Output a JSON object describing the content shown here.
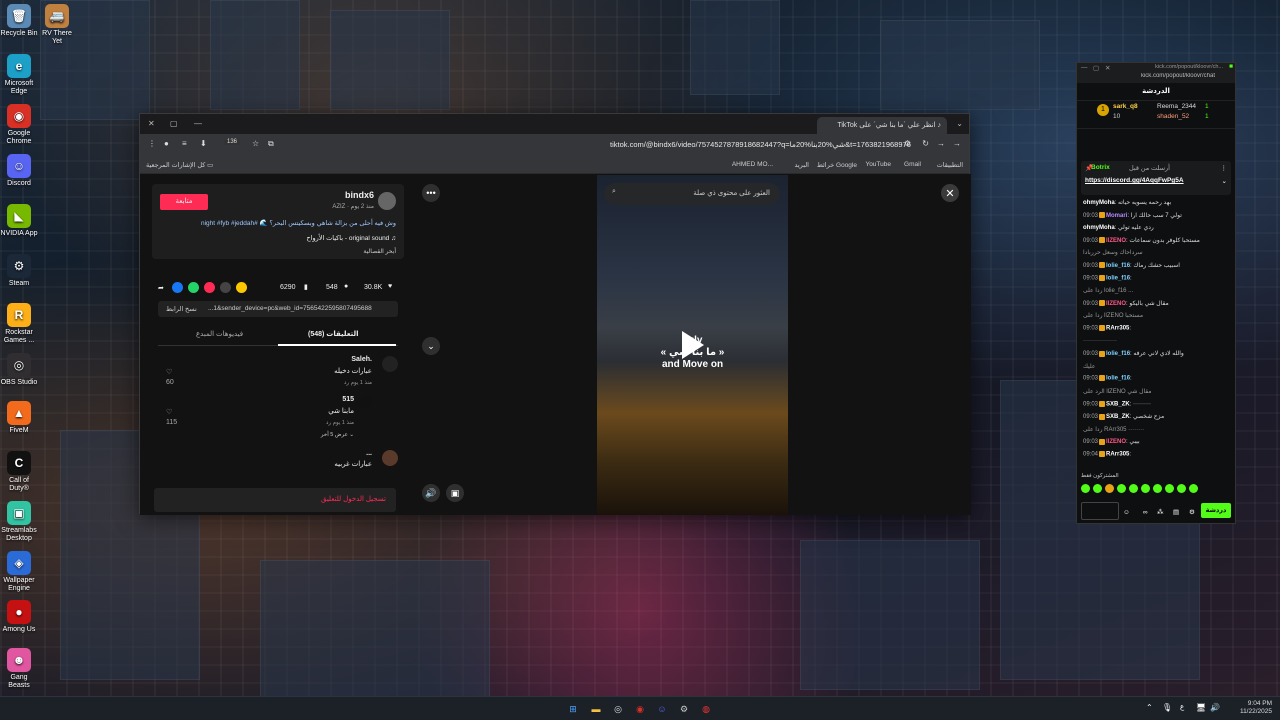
{
  "desktop": {
    "icons": [
      {
        "label": "Recycle Bin",
        "icon": "recycle-bin-icon",
        "color": "#5b8bb5",
        "glyph": "🗑"
      },
      {
        "label": "Microsoft Edge",
        "icon": "edge-icon",
        "color": "#1da0c8",
        "glyph": "e"
      },
      {
        "label": "Google Chrome",
        "icon": "chrome-icon",
        "color": "#d93025",
        "glyph": "◉"
      },
      {
        "label": "Discord",
        "icon": "discord-icon",
        "color": "#5865f2",
        "glyph": "☺"
      },
      {
        "label": "NVIDIA App",
        "icon": "nvidia-icon",
        "color": "#76b900",
        "glyph": "◣"
      },
      {
        "label": "Steam",
        "icon": "steam-icon",
        "color": "#1b2838",
        "glyph": "⚙"
      },
      {
        "label": "Rockstar Games ...",
        "icon": "rockstar-icon",
        "color": "#fcaf17",
        "glyph": "R"
      },
      {
        "label": "OBS Studio",
        "icon": "obs-icon",
        "color": "#302e31",
        "glyph": "◎"
      },
      {
        "label": "FiveM",
        "icon": "fivem-icon",
        "color": "#f26b1d",
        "glyph": "▲"
      },
      {
        "label": "Call of Duty®",
        "icon": "cod-icon",
        "color": "#111111",
        "glyph": "C"
      },
      {
        "label": "Streamlabs Desktop",
        "icon": "streamlabs-icon",
        "color": "#31c3a2",
        "glyph": "▣"
      },
      {
        "label": "Wallpaper Engine",
        "icon": "wallpaper-engine-icon",
        "color": "#2a6bd8",
        "glyph": "◈"
      },
      {
        "label": "Among Us",
        "icon": "among-us-icon",
        "color": "#c51111",
        "glyph": "●"
      },
      {
        "label": "Gang Beasts",
        "icon": "gang-beasts-icon",
        "color": "#e056a0",
        "glyph": "☻"
      }
    ],
    "extra_icon": {
      "label": "RV There Yet",
      "icon": "rv-there-yet-icon",
      "color": "#c08040"
    }
  },
  "browser": {
    "tab_title": "انظر علي ´ما بنا شي´ على TikTok",
    "url": "tiktok.com/@bindx6/video/7574527878918682447?q=شي%20بنا%20ما&t=1763821968976",
    "bookmarks": [
      "التطبيقات",
      "AHMED MO...",
      "البريد",
      "خرائط Google",
      "YouTube",
      "Gmail"
    ],
    "all_bookmarks": "كل الإشارات المرجعية",
    "profile": {
      "username": "bindx6",
      "display": "AZIZ · منذ 2 يوم",
      "follow": "متابعة",
      "caption": "وش فيه أحلى من بزالة شاهي وبسكيتس البحر؟ 🌊 #night #fyb #jeddah",
      "sound": "♫ original sound - باكيات الأرواح",
      "explore": "أبحر القصالية"
    },
    "stats": {
      "likes": "30.8K",
      "comments": "548",
      "saves": "6290"
    },
    "link_label": "نسخ الرابط",
    "link_text": "...1&sender_device=pc&web_id=7565422595807495688",
    "tabs": {
      "comments": "التعليقات (548)",
      "related": "فيديوهات المبدع"
    },
    "comments": [
      {
        "user": "Saleh.",
        "text": "عبارات دخيله",
        "meta": "منذ 1 يوم   رد",
        "likes": "60"
      },
      {
        "user": "515",
        "text": "مابنا شي",
        "meta": "منذ 1 يوم   رد",
        "likes": "115",
        "replies": "عرض 5 آخر ⌄"
      },
      {
        "user": "...",
        "text": "عبارات غربيه",
        "meta": "",
        "likes": ""
      }
    ],
    "login_prompt": "تسجيل الدخول للتعليق",
    "video": {
      "search_placeholder": "العثور على محتوى ذي صلة",
      "overlay": [
        "July",
        "« ما بنا شي »",
        "and Move on"
      ]
    }
  },
  "kick": {
    "url": "kick.com/popout/kloovr/chat",
    "page_url": "kick.com/popout/kloovr/ch...",
    "title": "الدردشة",
    "top_gifters": [
      {
        "rank": "1",
        "name": "sark_q8",
        "count": "10"
      },
      {
        "rank": "",
        "name": "Reema_2344",
        "count": "1"
      },
      {
        "rank": "",
        "name": "shaden_52",
        "count": "1"
      }
    ],
    "pinned": {
      "by": "Botrix",
      "label": "أرسلت من قبل",
      "link": "https://discord.gg/4AqqFwPg5A"
    },
    "messages": [
      {
        "time": "",
        "user": "ohmyMoha",
        "text": "بهد رحمه يسويه حياته"
      },
      {
        "time": "09:03",
        "user": "Momari",
        "text": "تولي 7 سب حالك ارا"
      },
      {
        "time": "",
        "user": "ohmyMoha",
        "text": "ردي عليه تولي"
      },
      {
        "time": "09:03",
        "user": "llZENO",
        "text": "مستحبا كلوفر بدون سماعات"
      },
      {
        "time": "",
        "user": "",
        "text": "سرداحاك وسعل حرربادا"
      },
      {
        "time": "09:03",
        "user": "lolie_f16",
        "text": "اسبيب حشك رماك"
      },
      {
        "time": "09:03",
        "user": "lolie_f16",
        "text": ""
      },
      {
        "time": "",
        "user": "",
        "text": "ردا على lolie_f16 ..."
      },
      {
        "time": "09:03",
        "user": "llZENO",
        "text": "مقال شي باليكو"
      },
      {
        "time": "",
        "user": "",
        "text": "ردا على llZENO مستحبا"
      },
      {
        "time": "09:03",
        "user": "RArr305",
        "text": ""
      },
      {
        "time": "",
        "user": "",
        "text": "·················"
      },
      {
        "time": "09:03",
        "user": "lolie_f16",
        "text": "والله لادي لاني عرفه"
      },
      {
        "time": "",
        "user": "",
        "text": "عليك"
      },
      {
        "time": "09:03",
        "user": "lolie_f16",
        "text": ""
      },
      {
        "time": "",
        "user": "",
        "text": "الرد على llZENO مقال شي"
      },
      {
        "time": "09:03",
        "user": "SXB_ZK",
        "text": "·········"
      },
      {
        "time": "09:03",
        "user": "SXB_ZK",
        "text": "مزح شخصي"
      },
      {
        "time": "",
        "user": "",
        "text": "ردا على RArr305 ········"
      },
      {
        "time": "09:03",
        "user": "llZENO",
        "text": "بيبي"
      },
      {
        "time": "09:04",
        "user": "RArr305",
        "text": ""
      }
    ],
    "subscribers_label": "المشتركون فقط",
    "send_label": "دردشة"
  },
  "taskbar": {
    "time": "9:04 PM",
    "date": "11/22/2025",
    "lang": "ع"
  }
}
